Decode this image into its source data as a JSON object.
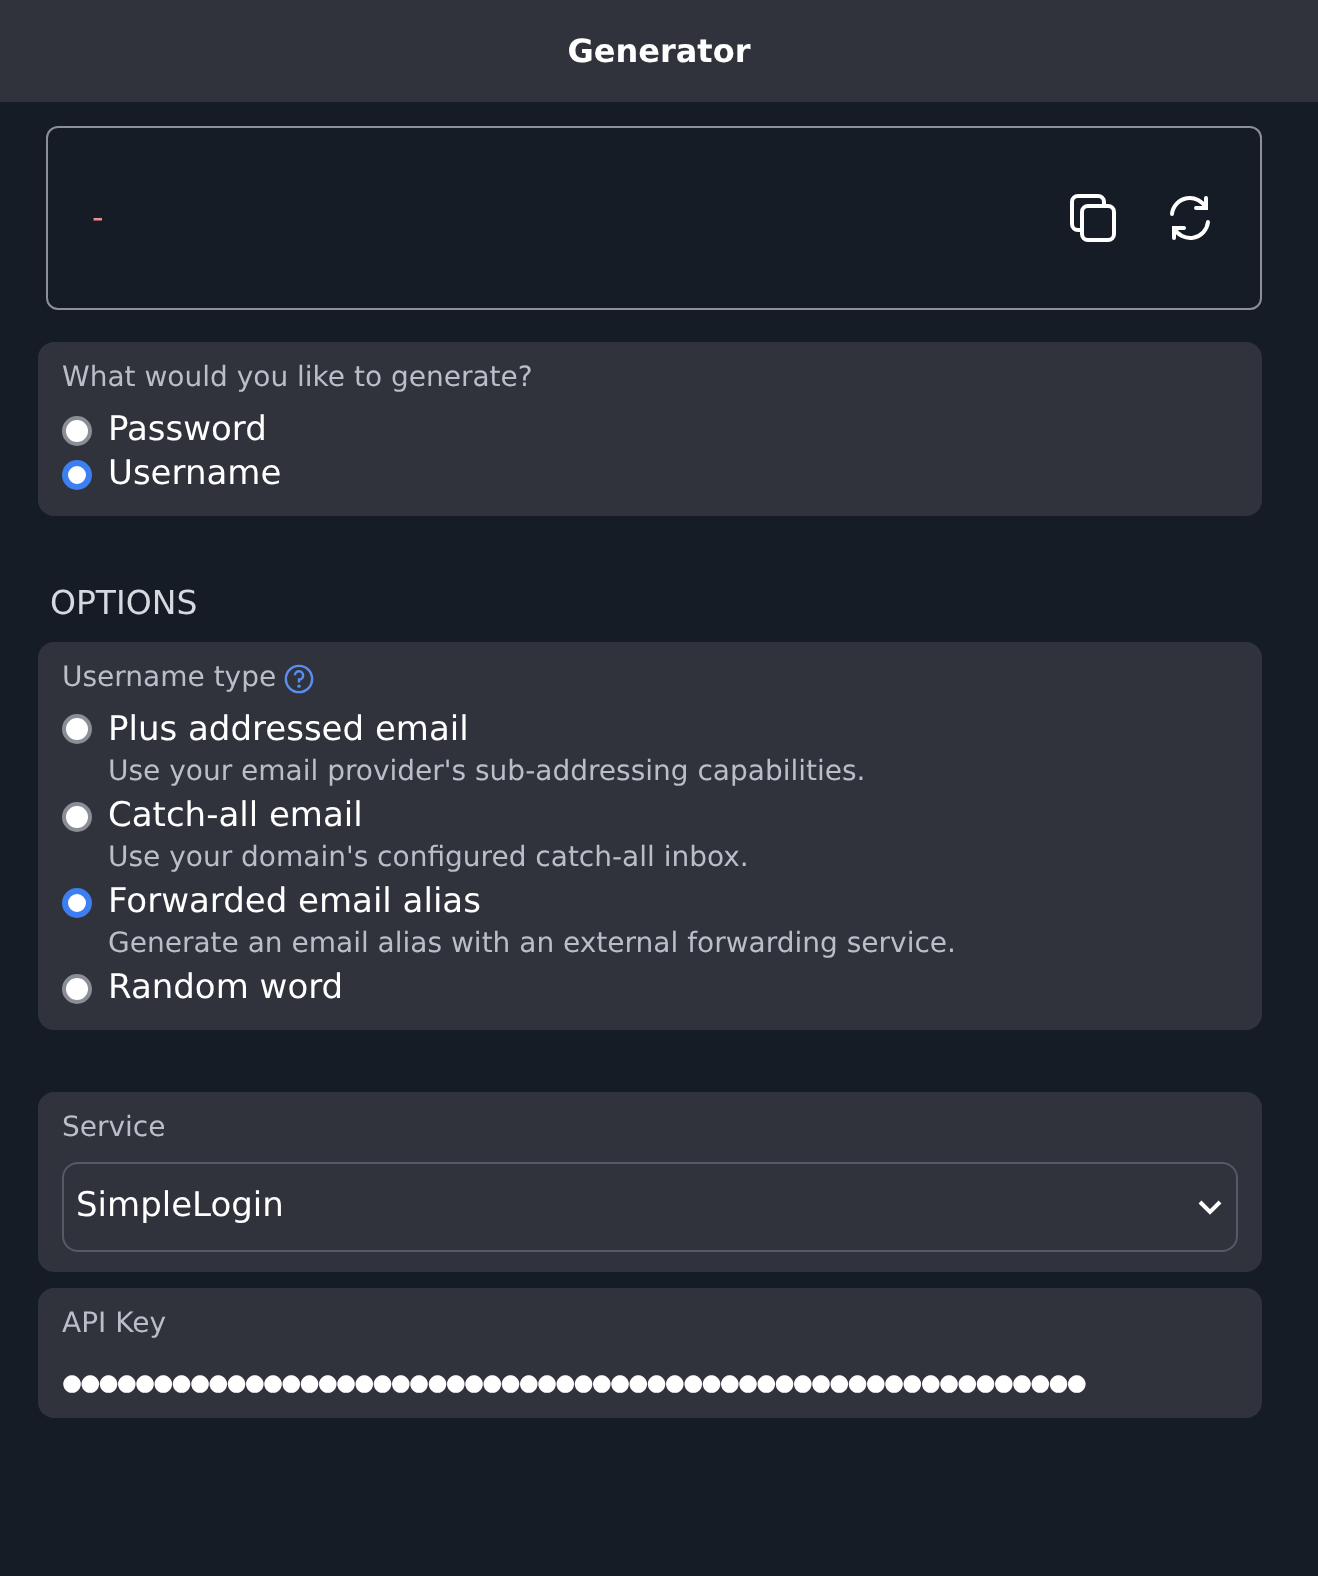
{
  "header": {
    "title": "Generator"
  },
  "generated": {
    "value": "-"
  },
  "generate_type": {
    "question": "What would you like to generate?",
    "options": [
      {
        "label": "Password",
        "selected": false
      },
      {
        "label": "Username",
        "selected": true
      }
    ]
  },
  "options_heading": "OPTIONS",
  "username_type": {
    "label": "Username type",
    "options": [
      {
        "label": "Plus addressed email",
        "description": "Use your email provider's sub-addressing capabilities.",
        "selected": false
      },
      {
        "label": "Catch-all email",
        "description": "Use your domain's configured catch-all inbox.",
        "selected": false
      },
      {
        "label": "Forwarded email alias",
        "description": "Generate an email alias with an external forwarding service.",
        "selected": true
      },
      {
        "label": "Random word",
        "selected": false
      }
    ]
  },
  "service": {
    "label": "Service",
    "value": "SimpleLogin"
  },
  "api_key": {
    "label": "API Key",
    "value": "●●●●●●●●●●●●●●●●●●●●●●●●●●●●●●●●●●●●●●●●●●●●●●●●●●●●●●●●"
  }
}
